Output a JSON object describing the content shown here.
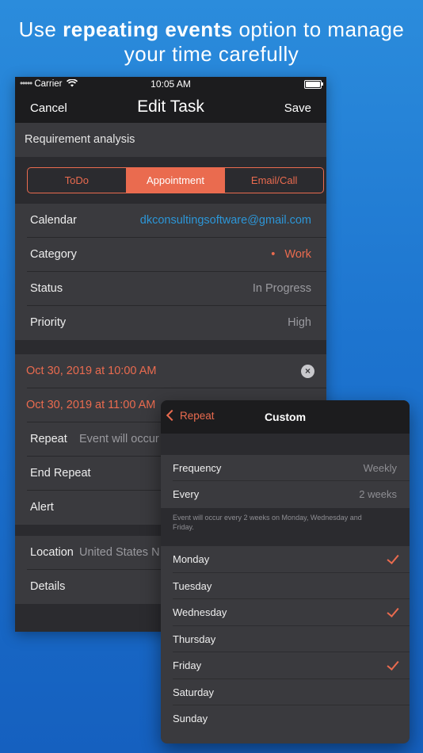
{
  "headline": {
    "pre": "Use ",
    "bold": "repeating events",
    "post": " option to manage",
    "line2": "your time carefully"
  },
  "status_bar": {
    "dots": "•••••",
    "carrier": "Carrier",
    "time": "10:05 AM"
  },
  "nav": {
    "cancel": "Cancel",
    "title": "Edit Task",
    "save": "Save"
  },
  "task_title": "Requirement analysis",
  "segments": {
    "todo": "ToDo",
    "appointment": "Appointment",
    "email_call": "Email/Call",
    "selected": "Appointment"
  },
  "details": {
    "calendar": {
      "label": "Calendar",
      "value": "dkconsultingsoftware@gmail.com"
    },
    "category": {
      "label": "Category",
      "value": "Work",
      "bullet": "•"
    },
    "status": {
      "label": "Status",
      "value": "In Progress"
    },
    "priority": {
      "label": "Priority",
      "value": "High"
    }
  },
  "dates": {
    "start": "Oct 30, 2019 at 10:00 AM",
    "end": "Oct 30, 2019 at 11:00 AM",
    "clear_symbol": "×"
  },
  "repeat": {
    "label": "Repeat",
    "value": "Event will occur"
  },
  "end_repeat": {
    "label": "End Repeat"
  },
  "alert": {
    "label": "Alert"
  },
  "location": {
    "label": "Location",
    "value": "United States N"
  },
  "details_row": {
    "label": "Details"
  },
  "custom": {
    "back": "Repeat",
    "title": "Custom",
    "frequency": {
      "label": "Frequency",
      "value": "Weekly"
    },
    "every": {
      "label": "Every",
      "value": "2 weeks"
    },
    "footnote": "Event will occur every 2 weeks on Monday, Wednesday and Friday.",
    "days": [
      {
        "name": "Monday",
        "checked": true
      },
      {
        "name": "Tuesday",
        "checked": false
      },
      {
        "name": "Wednesday",
        "checked": true
      },
      {
        "name": "Thursday",
        "checked": false
      },
      {
        "name": "Friday",
        "checked": true
      },
      {
        "name": "Saturday",
        "checked": false
      },
      {
        "name": "Sunday",
        "checked": false
      }
    ]
  },
  "colors": {
    "accent": "#ea6b4f",
    "link": "#2c96d8",
    "background_top": "#2b8cdc",
    "background_bottom": "#1560bf"
  }
}
